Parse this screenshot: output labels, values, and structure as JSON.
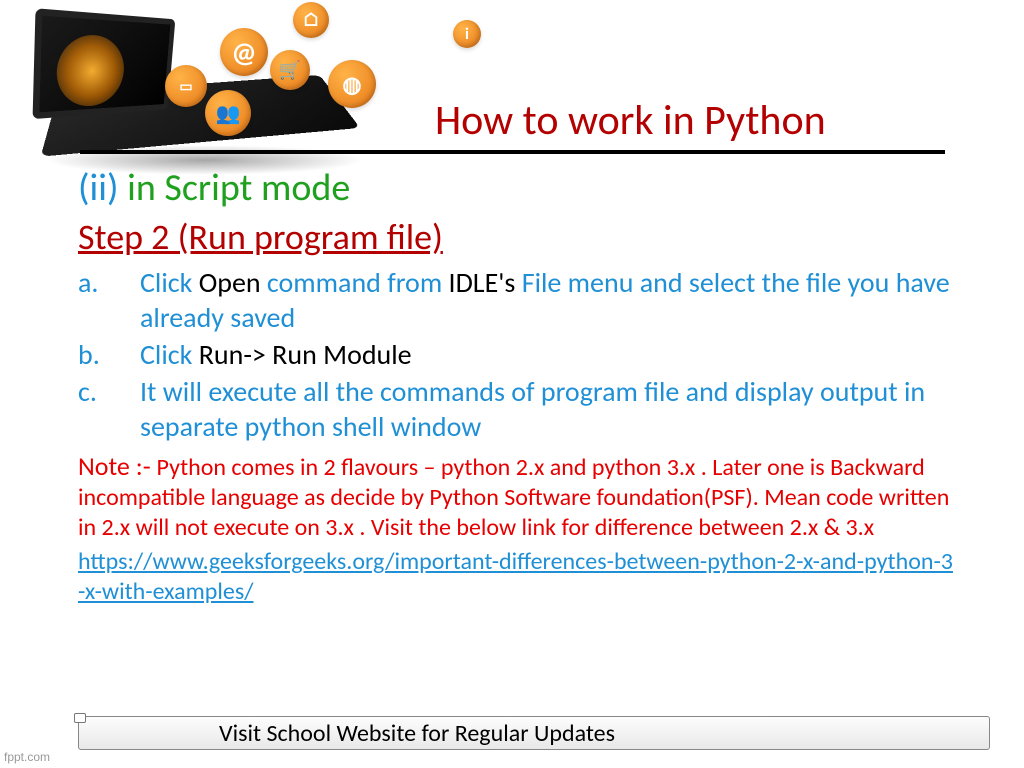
{
  "header": {
    "title": "How to work in Python"
  },
  "subtitle": {
    "roman": "(ii)",
    "text": "in Script mode"
  },
  "step": {
    "title": "Step 2 (Run program file)"
  },
  "items": {
    "a": {
      "letter": "a.",
      "p1": "Click ",
      "p2": "Open ",
      "p3": "command from ",
      "p4": "IDLE's ",
      "p5": "File menu and select the file you have already saved"
    },
    "b": {
      "letter": "b.",
      "p1": "Click ",
      "p2": "Run-> ",
      "p3": "Run Module"
    },
    "c": {
      "letter": "c.",
      "text": "It will execute all the commands of program file and display output in separate python shell window"
    }
  },
  "note": {
    "label": "Note :- ",
    "body": "Python comes in 2 flavours – python 2.x and python 3.x . Later one is Backward incompatible language as decide by Python Software foundation(PSF). Mean code written in 2.x will not execute on 3.x . Visit the below link for difference between 2.x & 3.x"
  },
  "link": {
    "text": "https://www.geeksforgeeks.org/important-differences-between-python-2-x-and-python-3-x-with-examples/"
  },
  "footer": {
    "text": "Visit School Website for Regular Updates"
  },
  "watermark": "fppt.com",
  "icons": {
    "at": "@",
    "home": "⌂",
    "info": "i",
    "chat": "▭",
    "cart": "🛒",
    "globe": "◍",
    "people": "👥"
  }
}
